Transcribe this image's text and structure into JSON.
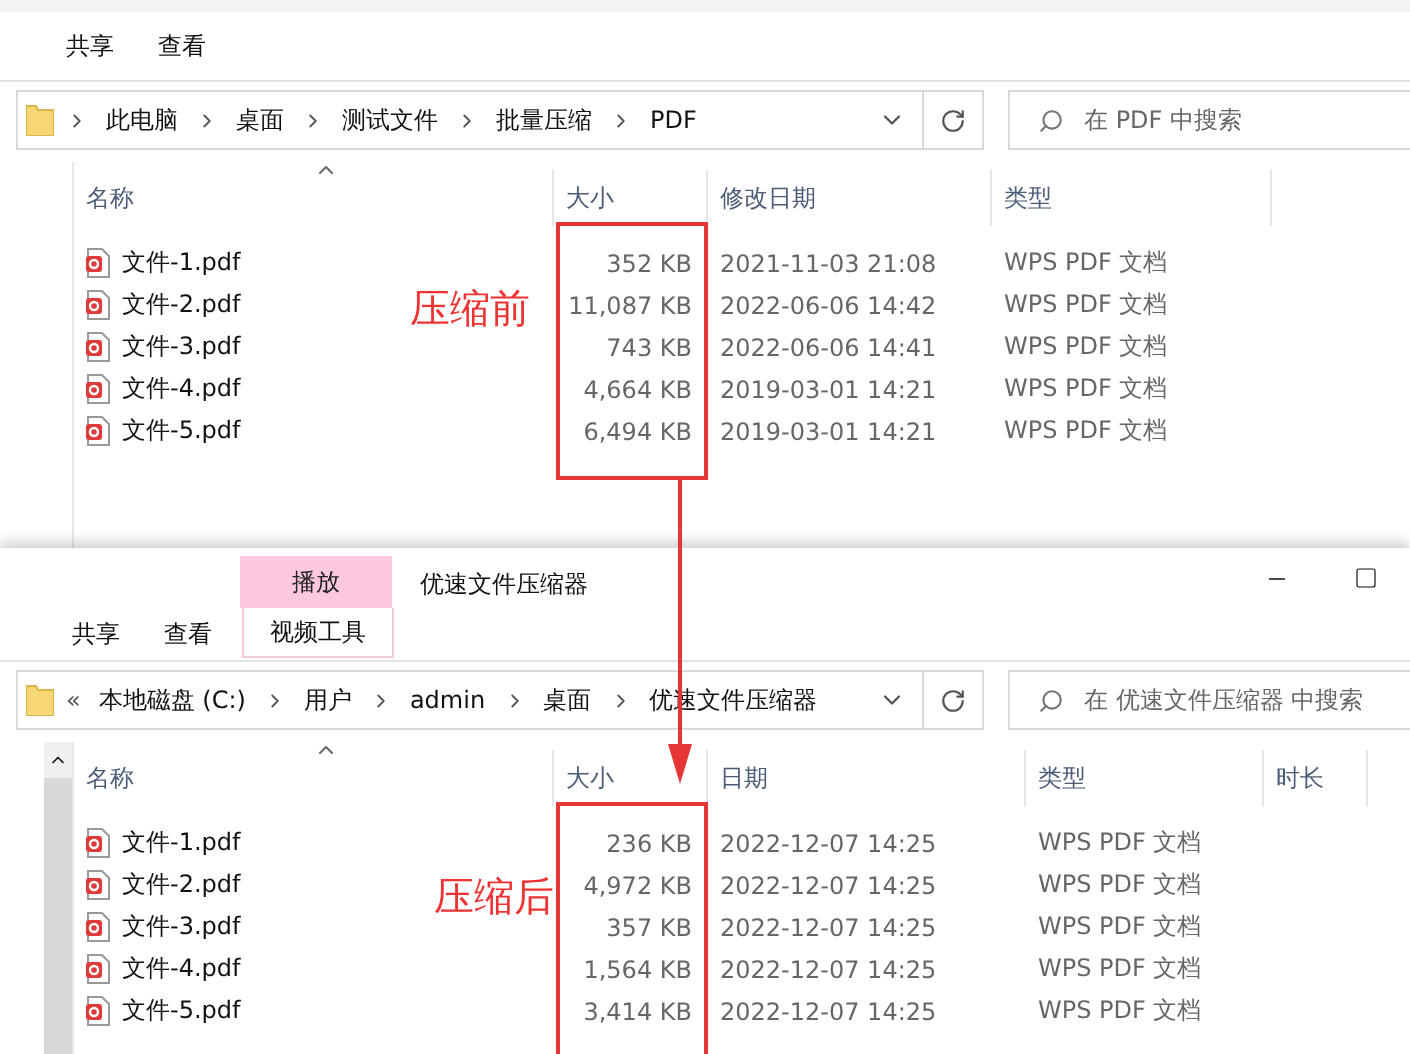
{
  "windows": [
    {
      "ribbon_tabs": [
        {
          "label": "共享"
        },
        {
          "label": "查看"
        }
      ],
      "address": {
        "crumbs": [
          "此电脑",
          "桌面",
          "测试文件",
          "批量压缩",
          "PDF"
        ]
      },
      "search": {
        "placeholder": "在 PDF 中搜索"
      },
      "columns": [
        {
          "label": "名称",
          "kind": "name"
        },
        {
          "label": "大小",
          "kind": "size"
        },
        {
          "label": "修改日期",
          "kind": "date"
        },
        {
          "label": "类型",
          "kind": "type"
        }
      ],
      "files": [
        {
          "name": "文件-1.pdf",
          "size": "352 KB",
          "date": "2021-11-03 21:08",
          "type": "WPS PDF 文档"
        },
        {
          "name": "文件-2.pdf",
          "size": "11,087 KB",
          "date": "2022-06-06 14:42",
          "type": "WPS PDF 文档"
        },
        {
          "name": "文件-3.pdf",
          "size": "743 KB",
          "date": "2022-06-06 14:41",
          "type": "WPS PDF 文档"
        },
        {
          "name": "文件-4.pdf",
          "size": "4,664 KB",
          "date": "2019-03-01 14:21",
          "type": "WPS PDF 文档"
        },
        {
          "name": "文件-5.pdf",
          "size": "6,494 KB",
          "date": "2019-03-01 14:21",
          "type": "WPS PDF 文档"
        }
      ],
      "annotation": "压缩前"
    },
    {
      "title": "优速文件压缩器",
      "contextual_tab": {
        "group": "播放",
        "label": "视频工具"
      },
      "ribbon_tabs": [
        {
          "label": "共享"
        },
        {
          "label": "查看"
        }
      ],
      "address": {
        "overflow": "«",
        "crumbs": [
          "本地磁盘 (C:)",
          "用户",
          "admin",
          "桌面",
          "优速文件压缩器"
        ]
      },
      "search": {
        "placeholder": "在 优速文件压缩器 中搜索"
      },
      "columns": [
        {
          "label": "名称",
          "kind": "name"
        },
        {
          "label": "大小",
          "kind": "size"
        },
        {
          "label": "日期",
          "kind": "date"
        },
        {
          "label": "类型",
          "kind": "type"
        },
        {
          "label": "时长",
          "kind": "duration"
        }
      ],
      "files": [
        {
          "name": "文件-1.pdf",
          "size": "236 KB",
          "date": "2022-12-07 14:25",
          "type": "WPS PDF 文档"
        },
        {
          "name": "文件-2.pdf",
          "size": "4,972 KB",
          "date": "2022-12-07 14:25",
          "type": "WPS PDF 文档"
        },
        {
          "name": "文件-3.pdf",
          "size": "357 KB",
          "date": "2022-12-07 14:25",
          "type": "WPS PDF 文档"
        },
        {
          "name": "文件-4.pdf",
          "size": "1,564 KB",
          "date": "2022-12-07 14:25",
          "type": "WPS PDF 文档"
        },
        {
          "name": "文件-5.pdf",
          "size": "3,414 KB",
          "date": "2022-12-07 14:25",
          "type": "WPS PDF 文档"
        }
      ],
      "annotation": "压缩后"
    }
  ]
}
